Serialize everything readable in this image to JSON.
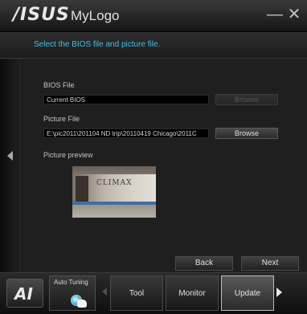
{
  "window": {
    "brand": "/ISUS",
    "title": "MyLogo",
    "minimize_symbol": "—",
    "close_symbol": "✕"
  },
  "instruction": "Select the BIOS file and picture file.",
  "bios_file": {
    "label": "BIOS File",
    "value": "Current BIOS",
    "browse_label": "Browse",
    "browse_enabled": false
  },
  "picture_file": {
    "label": "Picture File",
    "value": "E:\\pic2011\\201104 ND trip\\20110419 Chicago\\2011C",
    "browse_label": "Browse"
  },
  "preview": {
    "label": "Picture preview",
    "sign_text": "CLIMAX"
  },
  "navigation": {
    "back_label": "Back",
    "next_label": "Next"
  },
  "toolbar": {
    "ai_logo": "AI",
    "auto_tuning_label": "Auto Tuning",
    "items": [
      {
        "label": "Tool"
      },
      {
        "label": "Monitor"
      },
      {
        "label": "Update"
      }
    ],
    "active": "Update"
  },
  "colors": {
    "accent": "#3fc0e9",
    "background": "#1f1f1f"
  }
}
